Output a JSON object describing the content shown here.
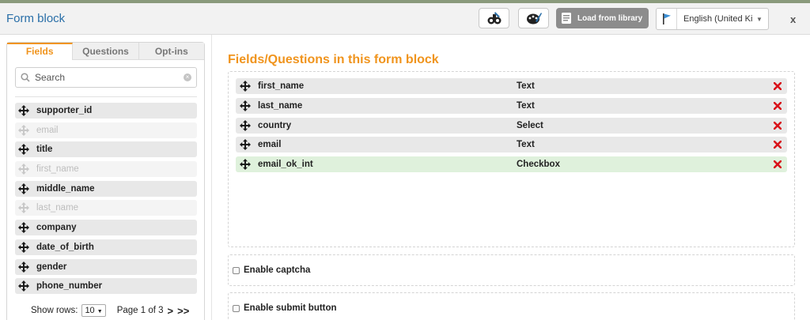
{
  "header": {
    "title": "Form block",
    "load_library_label": "Load from library",
    "language": "English (United Ki...",
    "close_label": "x"
  },
  "left_panel": {
    "tabs": [
      {
        "label": "Fields",
        "active": true
      },
      {
        "label": "Questions",
        "active": false
      },
      {
        "label": "Opt-ins",
        "active": false
      }
    ],
    "search": {
      "placeholder": "Search"
    },
    "fields": [
      {
        "label": "supporter_id",
        "enabled": true
      },
      {
        "label": "email",
        "enabled": false
      },
      {
        "label": "title",
        "enabled": true
      },
      {
        "label": "first_name",
        "enabled": false
      },
      {
        "label": "middle_name",
        "enabled": true
      },
      {
        "label": "last_name",
        "enabled": false
      },
      {
        "label": "company",
        "enabled": true
      },
      {
        "label": "date_of_birth",
        "enabled": true
      },
      {
        "label": "gender",
        "enabled": true
      },
      {
        "label": "phone_number",
        "enabled": true
      }
    ],
    "pager": {
      "show_rows_label": "Show rows:",
      "rows_value": "10",
      "page_text": "Page 1 of 3",
      "next_label": ">",
      "last_label": ">>"
    }
  },
  "main": {
    "heading": "Fields/Questions in this form block",
    "rows": [
      {
        "name": "first_name",
        "type": "Text",
        "highlighted": false
      },
      {
        "name": "last_name",
        "type": "Text",
        "highlighted": false
      },
      {
        "name": "country",
        "type": "Select",
        "highlighted": false
      },
      {
        "name": "email",
        "type": "Text",
        "highlighted": false
      },
      {
        "name": "email_ok_int",
        "type": "Checkbox",
        "highlighted": true
      }
    ],
    "options": [
      {
        "label": "Enable captcha",
        "checked": false
      },
      {
        "label": "Enable submit button",
        "checked": false
      }
    ]
  },
  "colors": {
    "accent_orange": "#f0941d",
    "title_blue": "#2a6fa8",
    "delete_red": "#d9121a",
    "highlight_green": "#dff1dc"
  }
}
